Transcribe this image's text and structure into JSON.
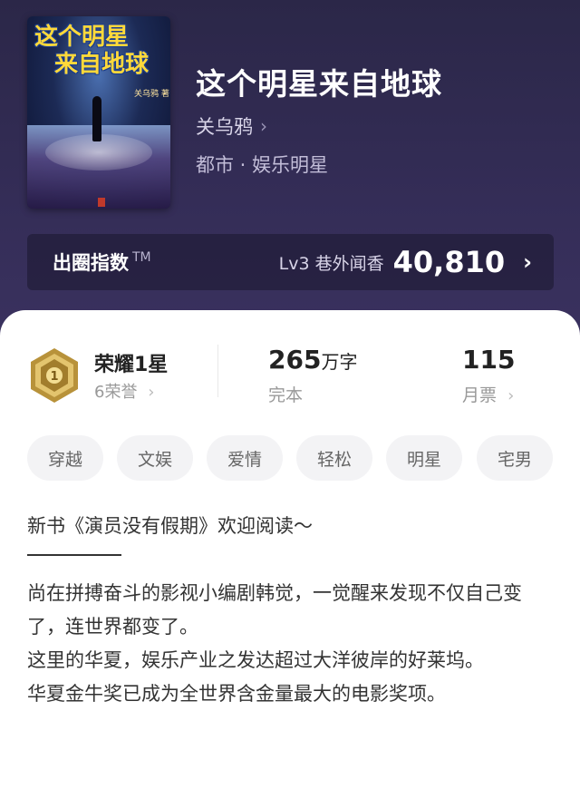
{
  "cover": {
    "title_line1": "这个明星",
    "title_line2": "来自地球",
    "author": "关乌鸦 著"
  },
  "book": {
    "title": "这个明星来自地球",
    "author": "关乌鸦",
    "genre": "都市 · 娱乐明星"
  },
  "score": {
    "label": "出圈指数",
    "tm": "TM",
    "level": "Lv3 巷外闻香",
    "value": "40,810"
  },
  "stats": {
    "honor_title": "荣耀1星",
    "honor_count": "6荣誉",
    "badge_number": "1",
    "words_num": "265",
    "words_unit": "万字",
    "status": "完本",
    "votes_num": "115",
    "votes_label": "月票"
  },
  "tags": [
    "穿越",
    "文娱",
    "爱情",
    "轻松",
    "明星",
    "宅男"
  ],
  "intro": {
    "headline": "新书《演员没有假期》欢迎阅读～",
    "paragraphs": [
      "尚在拼搏奋斗的影视小编剧韩觉，一觉醒来发现不仅自己变了，连世界都变了。",
      "这里的华夏，娱乐产业之发达超过大洋彼岸的好莱坞。",
      "华夏金牛奖已成为全世界含金量最大的电影奖项。"
    ]
  },
  "colors": {
    "header_bg": "#2b2748",
    "badge_gold": "#c9a24a"
  }
}
